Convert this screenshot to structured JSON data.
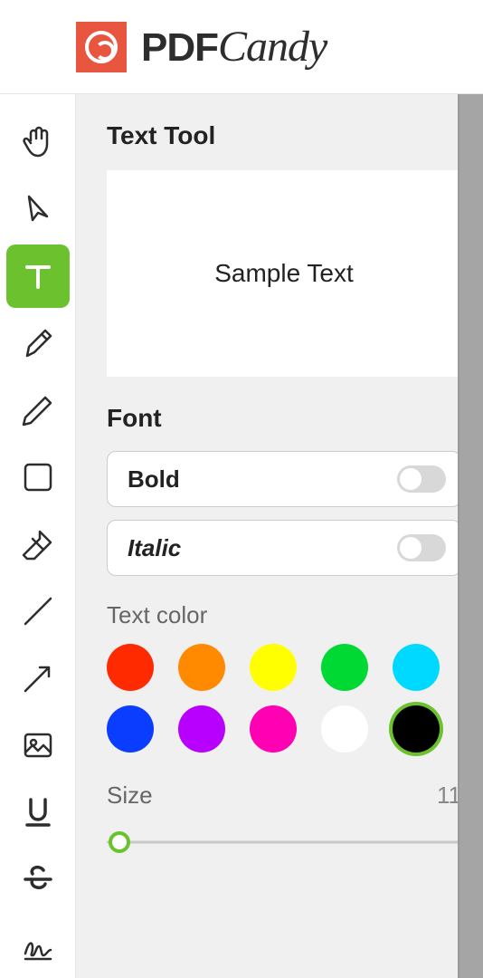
{
  "brand": {
    "pdf": "PDF",
    "candy": "Candy"
  },
  "panel": {
    "title": "Text Tool",
    "preview_text": "Sample Text",
    "font_title": "Font",
    "bold_label": "Bold",
    "italic_label": "Italic",
    "text_color_label": "Text color",
    "size_label": "Size",
    "size_value": "11"
  },
  "tools": {
    "active_index": 2,
    "items": [
      "hand",
      "arrow-pointer",
      "text",
      "highlighter",
      "pencil",
      "rectangle",
      "eraser",
      "line",
      "arrow-line",
      "image",
      "underline",
      "strikethrough",
      "signature"
    ]
  },
  "colors": [
    {
      "name": "red",
      "hex": "#ff2a00",
      "selected": false
    },
    {
      "name": "orange",
      "hex": "#ff8a00",
      "selected": false
    },
    {
      "name": "yellow",
      "hex": "#ffff00",
      "selected": false
    },
    {
      "name": "green",
      "hex": "#00d933",
      "selected": false
    },
    {
      "name": "cyan",
      "hex": "#00d9ff",
      "selected": false
    },
    {
      "name": "blue",
      "hex": "#0a3dff",
      "selected": false
    },
    {
      "name": "purple",
      "hex": "#b800ff",
      "selected": false
    },
    {
      "name": "magenta",
      "hex": "#ff00b3",
      "selected": false
    },
    {
      "name": "white",
      "hex": "#ffffff",
      "selected": false
    },
    {
      "name": "black",
      "hex": "#000000",
      "selected": true
    }
  ]
}
